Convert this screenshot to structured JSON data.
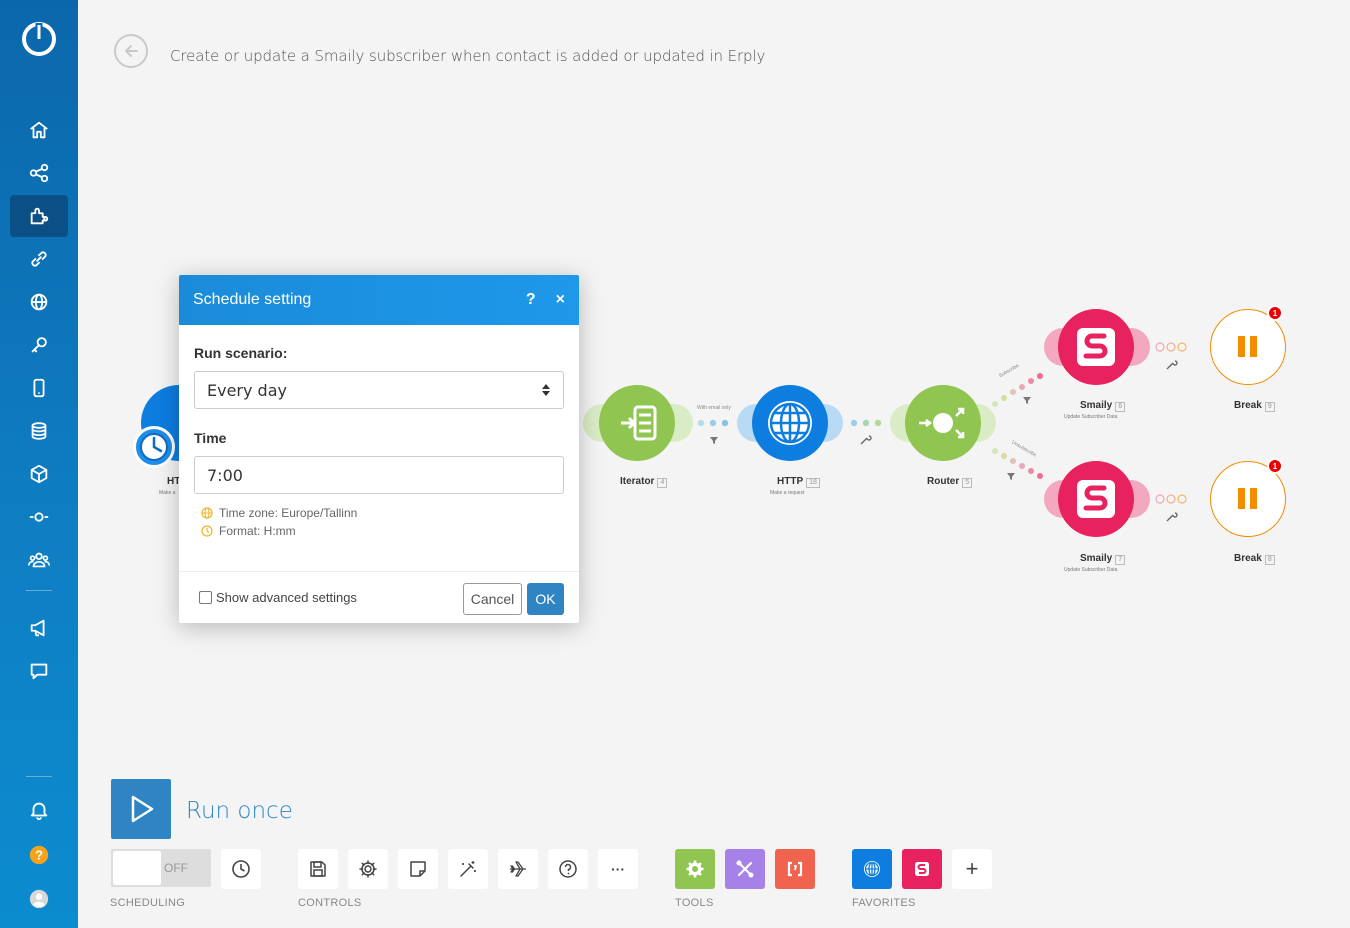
{
  "header": {
    "scenario_title": "Create or update a Smaily subscriber when contact is added or updated in Erply"
  },
  "sidebar": {
    "items": [
      {
        "name": "home",
        "icon": "home-icon"
      },
      {
        "name": "scenarios",
        "icon": "share-icon"
      },
      {
        "name": "templates",
        "icon": "puzzle-icon",
        "active": true
      },
      {
        "name": "connections",
        "icon": "link-icon"
      },
      {
        "name": "webhooks",
        "icon": "globe-icon"
      },
      {
        "name": "keys",
        "icon": "key-icon"
      },
      {
        "name": "devices",
        "icon": "phone-icon"
      },
      {
        "name": "data-stores",
        "icon": "database-icon"
      },
      {
        "name": "data-structures",
        "icon": "cube-icon"
      },
      {
        "name": "flow-control",
        "icon": "node-icon"
      },
      {
        "name": "team",
        "icon": "team-icon"
      },
      {
        "name": "announcements",
        "icon": "megaphone-icon"
      },
      {
        "name": "feedback",
        "icon": "chat-icon"
      },
      {
        "name": "notifications",
        "icon": "bell-icon"
      },
      {
        "name": "help",
        "icon": "help-icon"
      },
      {
        "name": "profile",
        "icon": "avatar-icon"
      }
    ]
  },
  "nodes": {
    "http1": {
      "label": "HT",
      "sub": "Make a"
    },
    "iterator": {
      "label": "Iterator",
      "num": "4"
    },
    "http2": {
      "label": "HTTP",
      "num": "18",
      "sub": "Make a request"
    },
    "router": {
      "label": "Router",
      "num": "5"
    },
    "smaily1": {
      "label": "Smaily",
      "num": "6",
      "sub": "Update Subscriber Data"
    },
    "smaily2": {
      "label": "Smaily",
      "num": "7",
      "sub": "Update Subscriber Data"
    },
    "break1": {
      "label": "Break",
      "num": "9",
      "badge": "1"
    },
    "break2": {
      "label": "Break",
      "num": "8",
      "badge": "1"
    }
  },
  "routes": {
    "filter1": "With email only",
    "subscribe": "Subscribe",
    "unsubscribe": "Unsubscribe"
  },
  "modal": {
    "title": "Schedule setting",
    "help": "?",
    "close": "×",
    "run_label": "Run scenario:",
    "run_value": "Every day",
    "time_label": "Time",
    "time_value": "7:00",
    "timezone_hint": "Time zone: Europe/Tallinn",
    "format_hint": "Format: H:mm",
    "advanced_label": "Show advanced settings",
    "cancel": "Cancel",
    "ok": "OK"
  },
  "toolbar": {
    "run_once": "Run once",
    "toggle": "OFF",
    "groups": {
      "scheduling": "SCHEDULING",
      "controls": "CONTROLS",
      "tools": "TOOLS",
      "favorites": "FAVORITES"
    },
    "more": "···",
    "add": "+"
  },
  "colors": {
    "sidebar": "#0b67ab",
    "http": "#0d7de0",
    "iterator": "#8fc550",
    "smaily": "#e8225f",
    "break": "#f28c00",
    "modal_header": "#1a8bd9",
    "ok_button": "#2f85c4",
    "tools_red": "#f0644f",
    "tools_purple": "#a682e8"
  }
}
